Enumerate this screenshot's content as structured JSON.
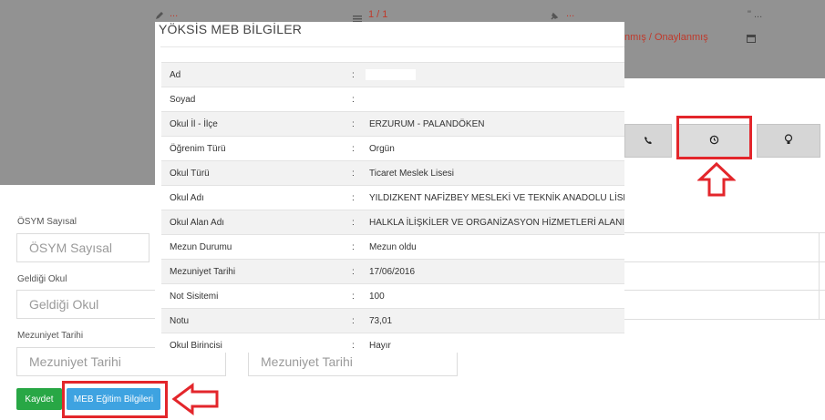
{
  "background": {
    "top_row": {
      "left_text": "...",
      "middle_text": "1 / 1",
      "right_text": "...",
      "quote_text": "\" ...",
      "status_text": "nmış / Onaylanmış"
    },
    "icons": [
      "pencil-icon",
      "list-icon",
      "pin-icon",
      "calendar-icon",
      "phone-icon",
      "history-icon",
      "lightbulb-icon"
    ],
    "form": {
      "osym_label": "ÖSYM Sayısal",
      "osym_placeholder": "ÖSYM Sayısal",
      "school_label": "Geldiği Okul",
      "school_placeholder": "Geldiği Okul",
      "grad_label": "Mezuniyet Tarihi",
      "grad_placeholder": "Mezuniyet Tarihi",
      "grad_placeholder_2": "Mezuniyet Tarihi"
    },
    "buttons": {
      "save": "Kaydet",
      "meb": "MEB Eğitim Bilgileri"
    }
  },
  "modal": {
    "title": "YÖKSİS MEB BİLGİLER",
    "separator": ":",
    "rows": [
      {
        "label": "Ad",
        "value": ""
      },
      {
        "label": "Soyad",
        "value": ""
      },
      {
        "label": "Okul İl - İlçe",
        "value": "ERZURUM - PALANDÖKEN"
      },
      {
        "label": "Öğrenim Türü",
        "value": "Orgün"
      },
      {
        "label": "Okul Türü",
        "value": "Ticaret Meslek Lisesi"
      },
      {
        "label": "Okul Adı",
        "value": "YILDIZKENT NAFİZBEY MESLEKİ VE TEKNİK ANADOLU LİSESİ"
      },
      {
        "label": "Okul Alan Adı",
        "value": "HALKLA İLİŞKİLER VE ORGANİZASYON HİZMETLERİ ALANI"
      },
      {
        "label": "Mezun Durumu",
        "value": "Mezun oldu"
      },
      {
        "label": "Mezuniyet Tarihi",
        "value": "17/06/2016"
      },
      {
        "label": "Not Sisitemi",
        "value": "100"
      },
      {
        "label": "Notu",
        "value": "73,01"
      },
      {
        "label": "Okul Birincisi",
        "value": "Hayır"
      }
    ]
  },
  "colors": {
    "highlight_red": "#e3262b",
    "save_green": "#28a745",
    "meb_blue": "#3ea3e1",
    "backdrop_gray": "#929292"
  }
}
